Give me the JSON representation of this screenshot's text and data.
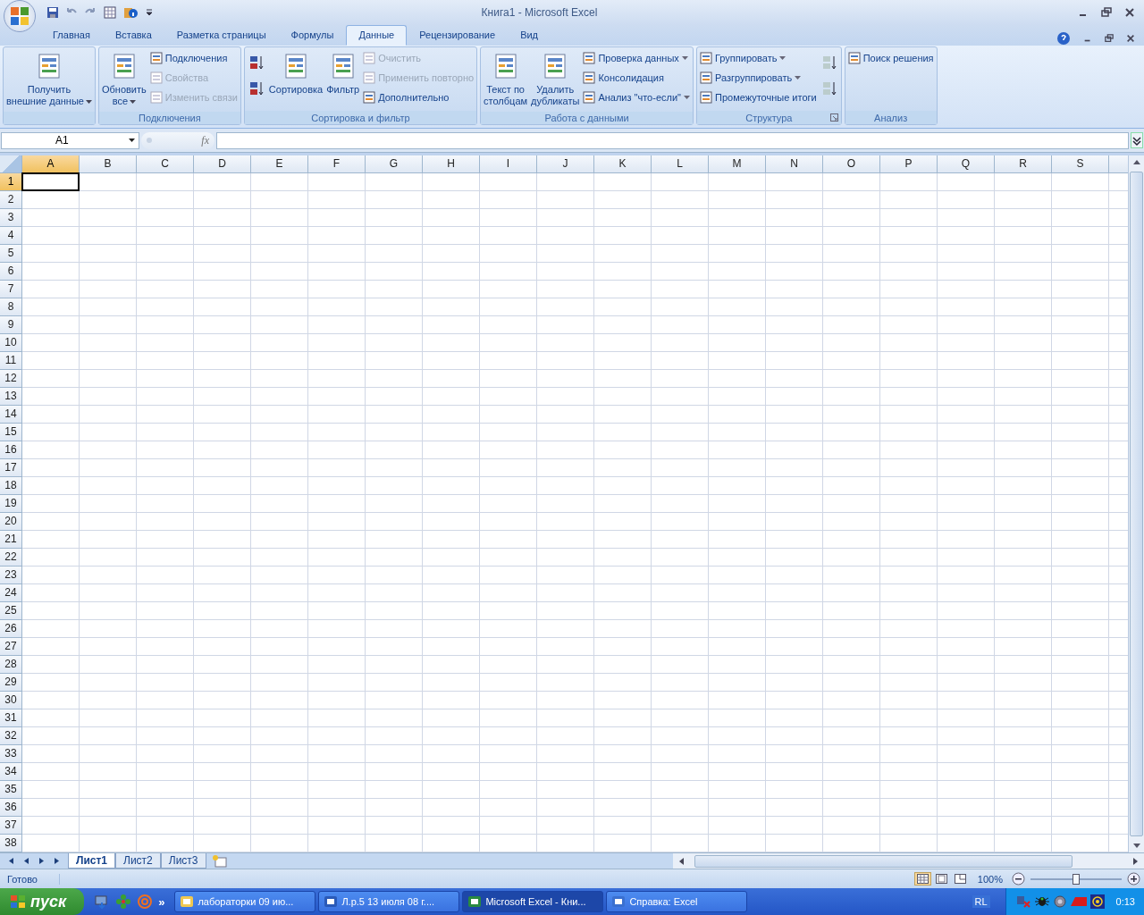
{
  "window": {
    "title": "Книга1  -  Microsoft Excel"
  },
  "tabs": [
    {
      "label": "Главная",
      "selected": false
    },
    {
      "label": "Вставка",
      "selected": false
    },
    {
      "label": "Разметка страницы",
      "selected": false
    },
    {
      "label": "Формулы",
      "selected": false
    },
    {
      "label": "Данные",
      "selected": true
    },
    {
      "label": "Рецензирование",
      "selected": false
    },
    {
      "label": "Вид",
      "selected": false
    }
  ],
  "ribbon": {
    "groups": [
      {
        "launcher": false,
        "columns": [
          [
            {
              "kind": "large",
              "label": "Получить\nвнешние данные",
              "disabled": false,
              "dropdown": true
            }
          ]
        ]
      },
      {
        "title": "Подключения",
        "launcher": false,
        "columns": [
          [
            {
              "kind": "large",
              "label": "Обновить\nвсе",
              "disabled": false,
              "dropdown": true
            }
          ],
          [
            {
              "kind": "small",
              "label": "Подключения",
              "disabled": false,
              "dropdown": false
            },
            {
              "kind": "small",
              "label": "Свойства",
              "disabled": true,
              "dropdown": false
            },
            {
              "kind": "small",
              "label": "Изменить связи",
              "disabled": true,
              "dropdown": false
            }
          ]
        ]
      },
      {
        "title": "Сортировка и фильтр",
        "launcher": false,
        "columns": [
          [
            {
              "kind": "icon",
              "disabled": false
            },
            {
              "kind": "icon",
              "disabled": false
            }
          ],
          [
            {
              "kind": "large",
              "label": "Сортировка",
              "disabled": false,
              "dropdown": false
            }
          ],
          [
            {
              "kind": "large",
              "label": "Фильтр",
              "disabled": false,
              "dropdown": false
            }
          ],
          [
            {
              "kind": "small",
              "label": "Очистить",
              "disabled": true,
              "dropdown": false
            },
            {
              "kind": "small",
              "label": "Применить повторно",
              "disabled": true,
              "dropdown": false
            },
            {
              "kind": "small",
              "label": "Дополнительно",
              "disabled": false,
              "dropdown": false
            }
          ]
        ]
      },
      {
        "title": "Работа с данными",
        "launcher": false,
        "columns": [
          [
            {
              "kind": "large",
              "label": "Текст по\nстолбцам",
              "disabled": false,
              "dropdown": false
            }
          ],
          [
            {
              "kind": "large",
              "label": "Удалить\nдубликаты",
              "disabled": false,
              "dropdown": false
            }
          ],
          [
            {
              "kind": "small",
              "label": "Проверка данных",
              "disabled": false,
              "dropdown": true
            },
            {
              "kind": "small",
              "label": "Консолидация",
              "disabled": false,
              "dropdown": false
            },
            {
              "kind": "small",
              "label": "Анализ \"что-если\"",
              "disabled": false,
              "dropdown": true
            }
          ]
        ]
      },
      {
        "title": "Структура",
        "launcher": true,
        "columns": [
          [
            {
              "kind": "small",
              "label": "Группировать",
              "disabled": false,
              "dropdown": true
            },
            {
              "kind": "small",
              "label": "Разгруппировать",
              "disabled": false,
              "dropdown": true
            },
            {
              "kind": "small",
              "label": "Промежуточные итоги",
              "disabled": false,
              "dropdown": false
            }
          ],
          [
            {
              "kind": "icon",
              "disabled": true
            },
            {
              "kind": "icon",
              "disabled": true
            }
          ]
        ]
      },
      {
        "title": "Анализ",
        "launcher": false,
        "columns": [
          [
            {
              "kind": "small",
              "label": "Поиск решения",
              "disabled": false,
              "dropdown": false
            }
          ]
        ]
      }
    ]
  },
  "formula_bar": {
    "name_box": "A1",
    "fx": "fx"
  },
  "grid": {
    "columns": [
      {
        "label": "A",
        "selected": true
      },
      {
        "label": "B",
        "selected": false
      },
      {
        "label": "C",
        "selected": false
      },
      {
        "label": "D",
        "selected": false
      },
      {
        "label": "E",
        "selected": false
      },
      {
        "label": "F",
        "selected": false
      },
      {
        "label": "G",
        "selected": false
      },
      {
        "label": "H",
        "selected": false
      },
      {
        "label": "I",
        "selected": false
      },
      {
        "label": "J",
        "selected": false
      },
      {
        "label": "K",
        "selected": false
      },
      {
        "label": "L",
        "selected": false
      },
      {
        "label": "M",
        "selected": false
      },
      {
        "label": "N",
        "selected": false
      },
      {
        "label": "O",
        "selected": false
      },
      {
        "label": "P",
        "selected": false
      },
      {
        "label": "Q",
        "selected": false
      },
      {
        "label": "R",
        "selected": false
      },
      {
        "label": "S",
        "selected": false
      }
    ],
    "rows": [
      {
        "label": "1",
        "selected": true
      },
      {
        "label": "2",
        "selected": false
      },
      {
        "label": "3",
        "selected": false
      },
      {
        "label": "4",
        "selected": false
      },
      {
        "label": "5",
        "selected": false
      },
      {
        "label": "6",
        "selected": false
      },
      {
        "label": "7",
        "selected": false
      },
      {
        "label": "8",
        "selected": false
      },
      {
        "label": "9",
        "selected": false
      },
      {
        "label": "10",
        "selected": false
      },
      {
        "label": "11",
        "selected": false
      },
      {
        "label": "12",
        "selected": false
      },
      {
        "label": "13",
        "selected": false
      },
      {
        "label": "14",
        "selected": false
      },
      {
        "label": "15",
        "selected": false
      },
      {
        "label": "16",
        "selected": false
      },
      {
        "label": "17",
        "selected": false
      },
      {
        "label": "18",
        "selected": false
      },
      {
        "label": "19",
        "selected": false
      },
      {
        "label": "20",
        "selected": false
      },
      {
        "label": "21",
        "selected": false
      },
      {
        "label": "22",
        "selected": false
      },
      {
        "label": "23",
        "selected": false
      },
      {
        "label": "24",
        "selected": false
      },
      {
        "label": "25",
        "selected": false
      },
      {
        "label": "26",
        "selected": false
      },
      {
        "label": "27",
        "selected": false
      },
      {
        "label": "28",
        "selected": false
      },
      {
        "label": "29",
        "selected": false
      },
      {
        "label": "30",
        "selected": false
      },
      {
        "label": "31",
        "selected": false
      },
      {
        "label": "32",
        "selected": false
      },
      {
        "label": "33",
        "selected": false
      },
      {
        "label": "34",
        "selected": false
      },
      {
        "label": "35",
        "selected": false
      },
      {
        "label": "36",
        "selected": false
      },
      {
        "label": "37",
        "selected": false
      },
      {
        "label": "38",
        "selected": false
      }
    ]
  },
  "sheet_tabs": [
    {
      "label": "Лист1",
      "selected": true
    },
    {
      "label": "Лист2",
      "selected": false
    },
    {
      "label": "Лист3",
      "selected": false
    }
  ],
  "status_bar": {
    "text": "Готово",
    "views": [
      {
        "selected": true
      },
      {
        "selected": false
      },
      {
        "selected": false
      }
    ],
    "zoom": "100%",
    "zoom_slider": {
      "level": 0.5
    }
  },
  "taskbar": {
    "start": "пуск",
    "more": "»",
    "tasks": [
      {
        "label": "лабораторки 09 ию...",
        "selected": false
      },
      {
        "label": "Л.р.5  13 июля 08 г....",
        "selected": false
      },
      {
        "label": "Microsoft Excel - Кни...",
        "selected": true
      },
      {
        "label": "Справка: Excel",
        "selected": false
      }
    ],
    "language": "RL",
    "clock": "0:13"
  }
}
